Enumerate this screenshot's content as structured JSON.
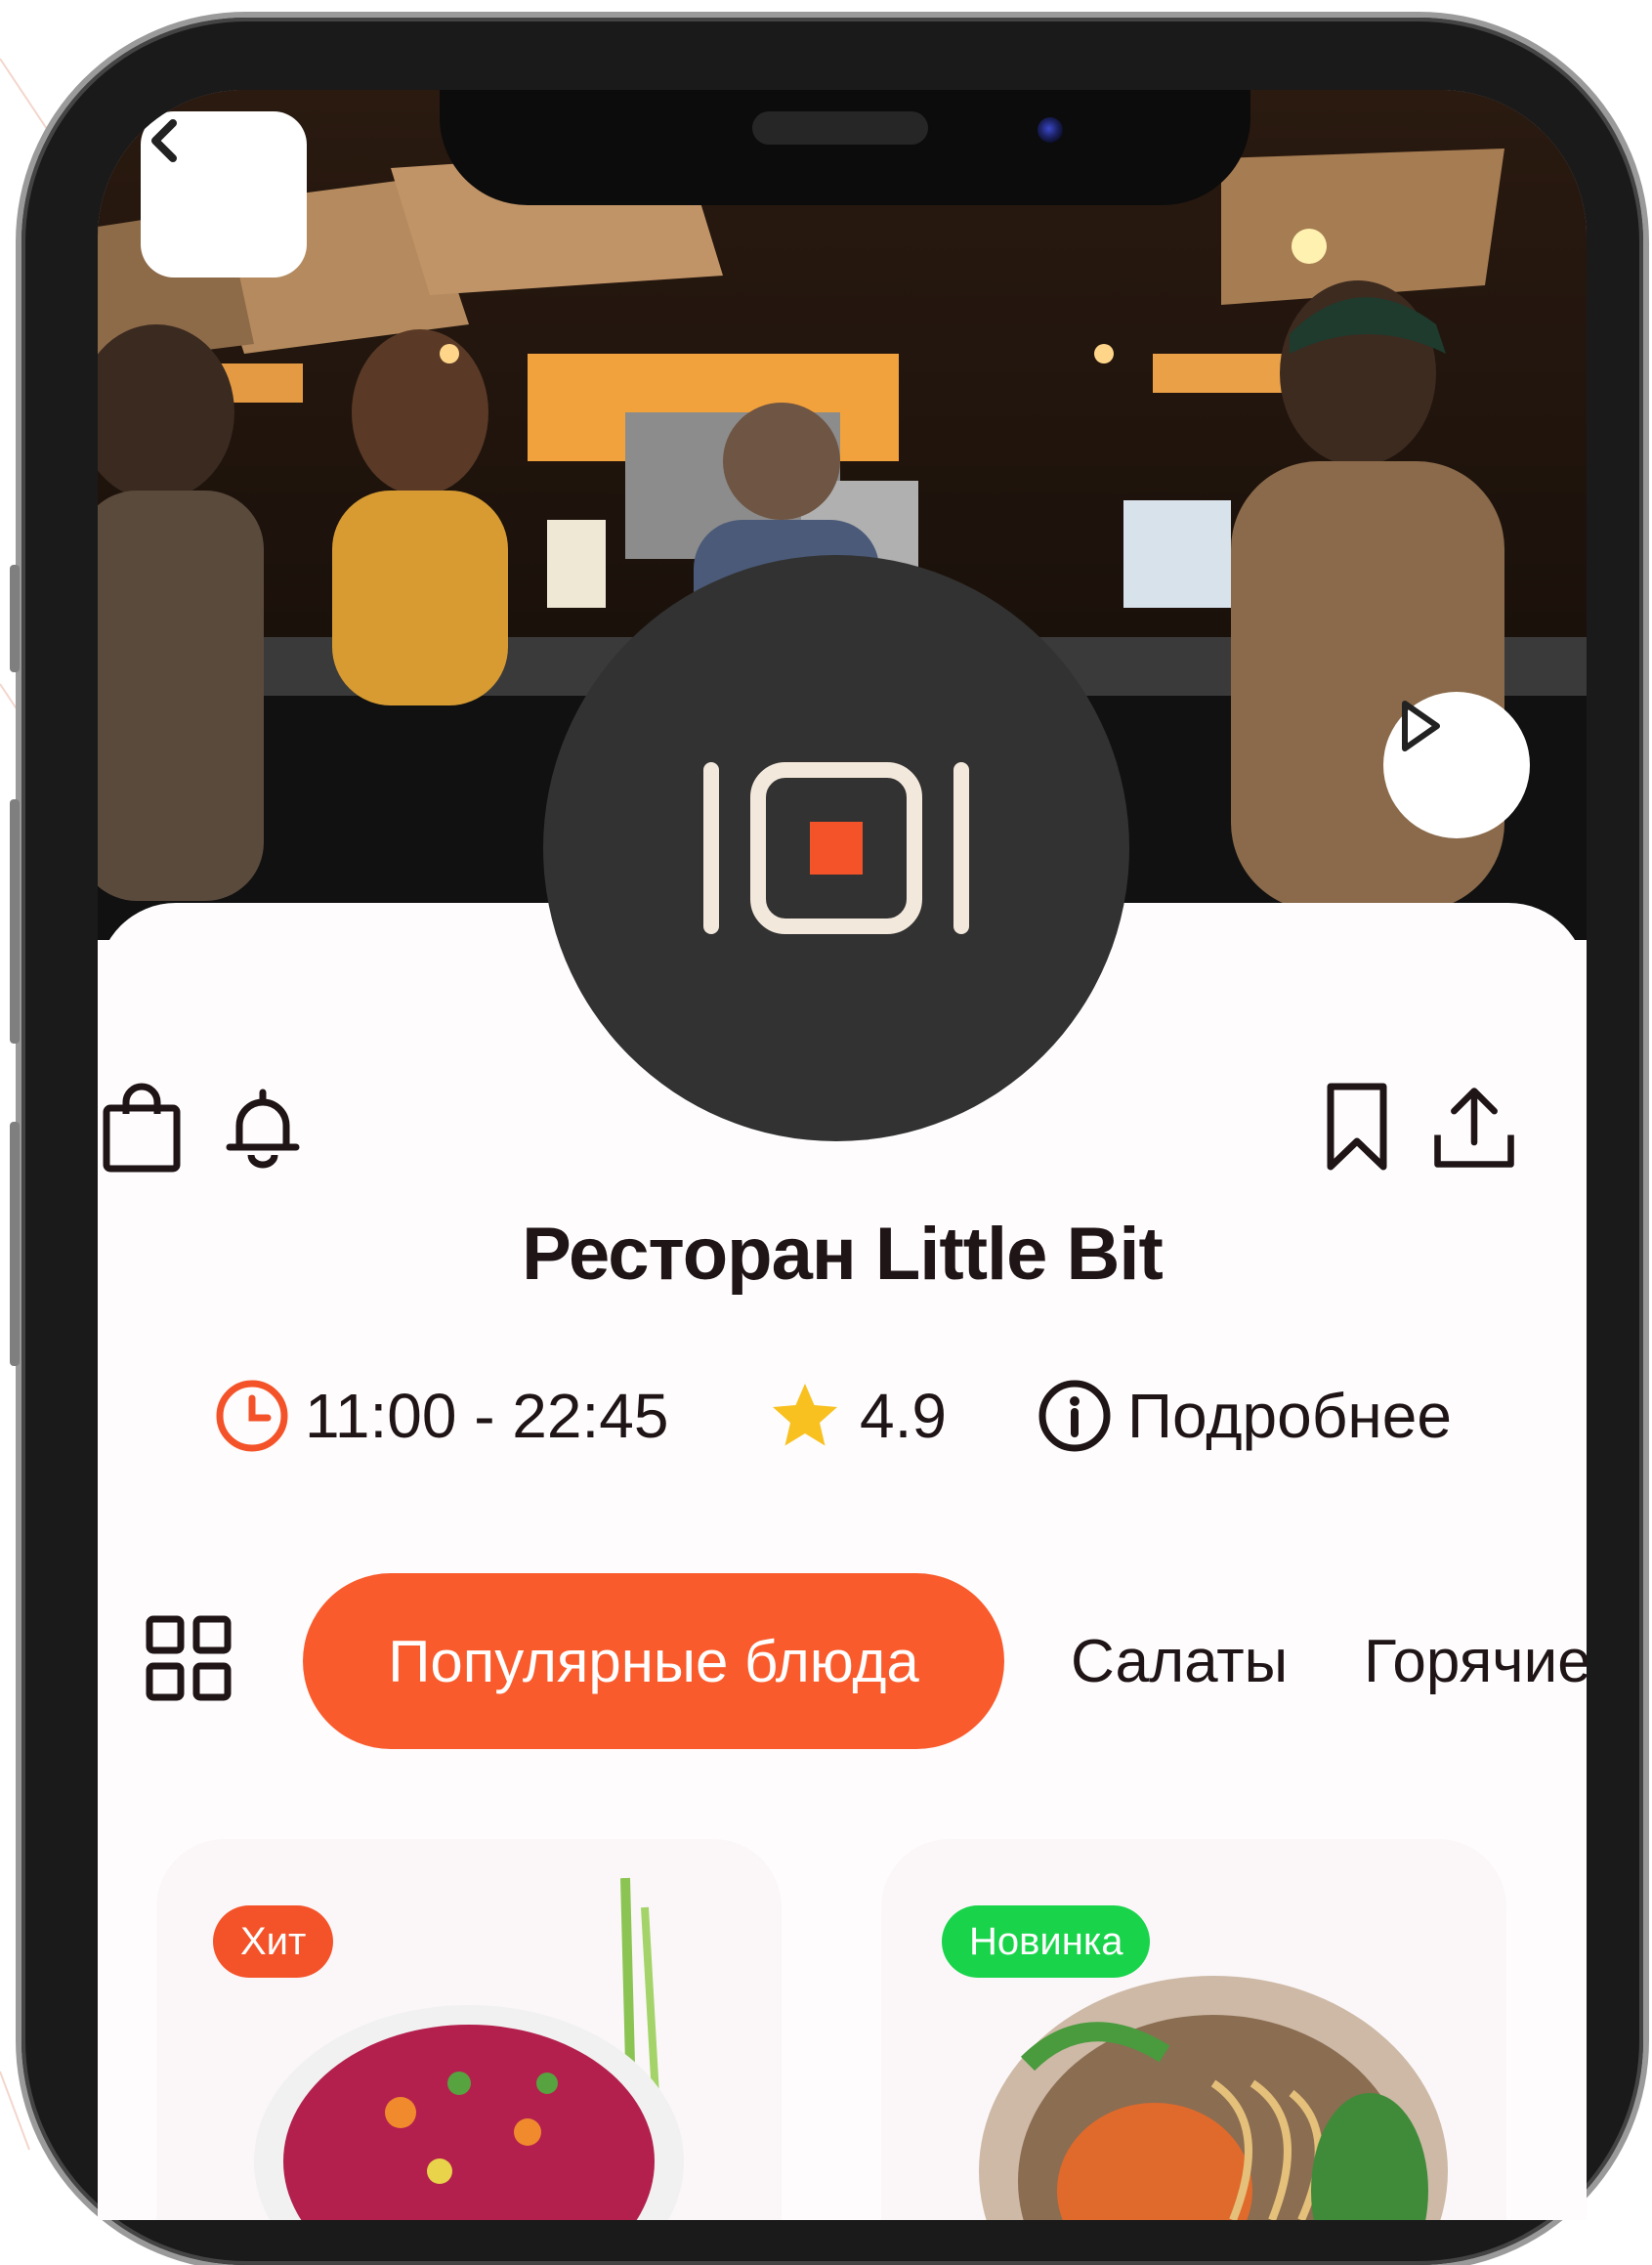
{
  "restaurant": {
    "title": "Ресторан Little Bit",
    "hours": "11:00 - 22:45",
    "rating": "4.9",
    "details_label": "Подробнее"
  },
  "tabs": {
    "active": "Популярные блюда",
    "items": [
      "Салаты",
      "Горячие"
    ]
  },
  "dishes": [
    {
      "badge": "Хит",
      "badge_color": "#f4532a"
    },
    {
      "badge": "Новинка",
      "badge_color": "#19d44b"
    }
  ],
  "colors": {
    "accent": "#f95b2c",
    "text": "#1f1416",
    "logo_bg": "#323232",
    "logo_stroke": "#f3e8dc",
    "star": "#f8c120"
  },
  "icons": {
    "top_left": [
      "bag-icon",
      "bell-icon"
    ],
    "top_right": [
      "bookmark-icon",
      "share-icon"
    ],
    "hero": [
      "back-icon",
      "play-icon"
    ],
    "info": [
      "clock-icon",
      "star-icon",
      "info-icon"
    ]
  }
}
